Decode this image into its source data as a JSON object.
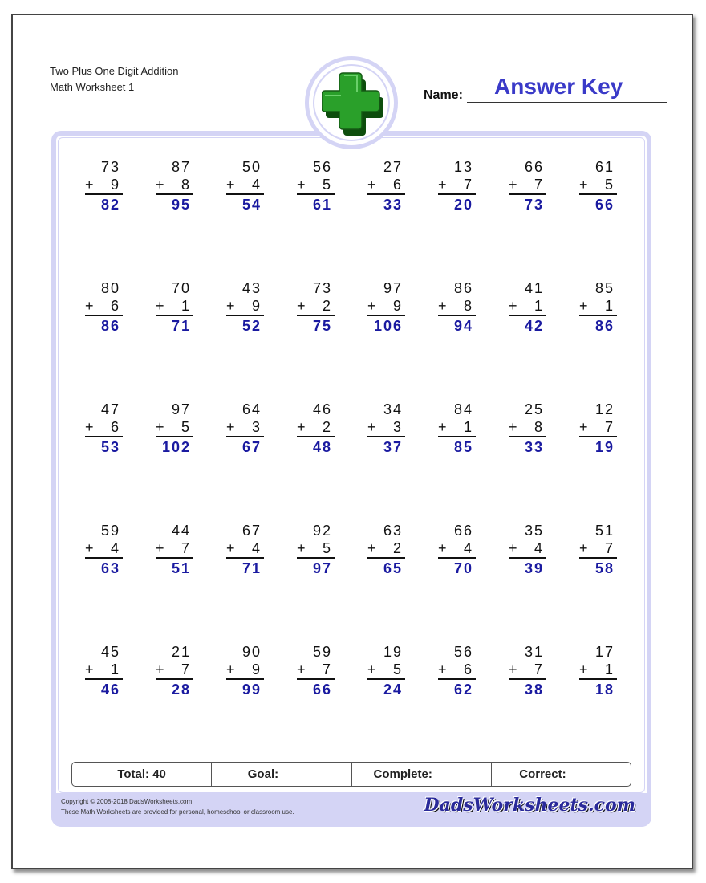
{
  "header": {
    "title_line1": "Two Plus One Digit Addition",
    "title_line2": "Math Worksheet 1",
    "name_label": "Name:",
    "name_value": "Answer Key",
    "emblem_icon": "plus-icon"
  },
  "problems": [
    [
      {
        "top": "73",
        "addend": "9",
        "answer": "82"
      },
      {
        "top": "87",
        "addend": "8",
        "answer": "95"
      },
      {
        "top": "50",
        "addend": "4",
        "answer": "54"
      },
      {
        "top": "56",
        "addend": "5",
        "answer": "61"
      },
      {
        "top": "27",
        "addend": "6",
        "answer": "33"
      },
      {
        "top": "13",
        "addend": "7",
        "answer": "20"
      },
      {
        "top": "66",
        "addend": "7",
        "answer": "73"
      },
      {
        "top": "61",
        "addend": "5",
        "answer": "66"
      }
    ],
    [
      {
        "top": "80",
        "addend": "6",
        "answer": "86"
      },
      {
        "top": "70",
        "addend": "1",
        "answer": "71"
      },
      {
        "top": "43",
        "addend": "9",
        "answer": "52"
      },
      {
        "top": "73",
        "addend": "2",
        "answer": "75"
      },
      {
        "top": "97",
        "addend": "9",
        "answer": "106"
      },
      {
        "top": "86",
        "addend": "8",
        "answer": "94"
      },
      {
        "top": "41",
        "addend": "1",
        "answer": "42"
      },
      {
        "top": "85",
        "addend": "1",
        "answer": "86"
      }
    ],
    [
      {
        "top": "47",
        "addend": "6",
        "answer": "53"
      },
      {
        "top": "97",
        "addend": "5",
        "answer": "102"
      },
      {
        "top": "64",
        "addend": "3",
        "answer": "67"
      },
      {
        "top": "46",
        "addend": "2",
        "answer": "48"
      },
      {
        "top": "34",
        "addend": "3",
        "answer": "37"
      },
      {
        "top": "84",
        "addend": "1",
        "answer": "85"
      },
      {
        "top": "25",
        "addend": "8",
        "answer": "33"
      },
      {
        "top": "12",
        "addend": "7",
        "answer": "19"
      }
    ],
    [
      {
        "top": "59",
        "addend": "4",
        "answer": "63"
      },
      {
        "top": "44",
        "addend": "7",
        "answer": "51"
      },
      {
        "top": "67",
        "addend": "4",
        "answer": "71"
      },
      {
        "top": "92",
        "addend": "5",
        "answer": "97"
      },
      {
        "top": "63",
        "addend": "2",
        "answer": "65"
      },
      {
        "top": "66",
        "addend": "4",
        "answer": "70"
      },
      {
        "top": "35",
        "addend": "4",
        "answer": "39"
      },
      {
        "top": "51",
        "addend": "7",
        "answer": "58"
      }
    ],
    [
      {
        "top": "45",
        "addend": "1",
        "answer": "46"
      },
      {
        "top": "21",
        "addend": "7",
        "answer": "28"
      },
      {
        "top": "90",
        "addend": "9",
        "answer": "99"
      },
      {
        "top": "59",
        "addend": "7",
        "answer": "66"
      },
      {
        "top": "19",
        "addend": "5",
        "answer": "24"
      },
      {
        "top": "56",
        "addend": "6",
        "answer": "62"
      },
      {
        "top": "31",
        "addend": "7",
        "answer": "38"
      },
      {
        "top": "17",
        "addend": "1",
        "answer": "18"
      }
    ]
  ],
  "operator": "+",
  "score": {
    "total": "Total: 40",
    "goal": "Goal: _____",
    "complete": "Complete: _____",
    "correct": "Correct: _____"
  },
  "footer": {
    "copyright": "Copyright © 2008-2018 DadsWorksheets.com",
    "usage": "These Math Worksheets are provided for personal, homeschool or classroom use.",
    "logo": "DadsWorksheets.com"
  },
  "colors": {
    "answer": "#1a1aa0",
    "answer_key": "#3a3ac8",
    "frame": "#d4d4f5",
    "emblem_green": "#2aa02a"
  }
}
